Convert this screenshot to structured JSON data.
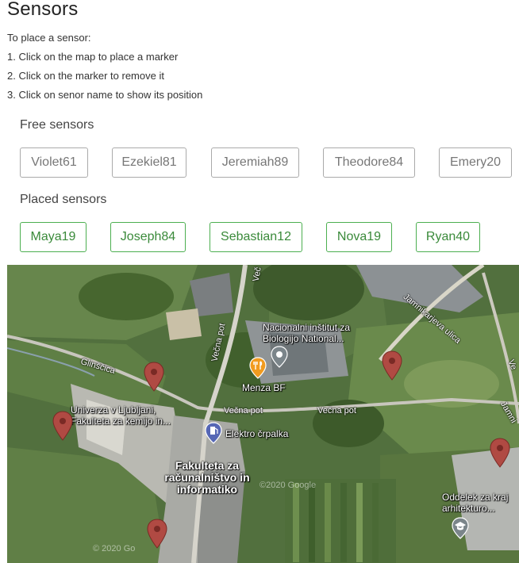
{
  "page": {
    "title": "Sensors",
    "instructions": [
      "To place a sensor:",
      "1. Click on the map to place a marker",
      "2. Click on the marker to remove it",
      "3. Click on senor name to show its position"
    ]
  },
  "free_sensors": {
    "title": "Free sensors",
    "items": [
      "Violet61",
      "Ezekiel81",
      "Jeremiah89",
      "Theodore84",
      "Emery20"
    ]
  },
  "placed_sensors": {
    "title": "Placed sensors",
    "items": [
      "Maya19",
      "Joseph84",
      "Sebastian12",
      "Nova19",
      "Ryan40"
    ]
  },
  "map": {
    "labels": {
      "institute": "Nacionalni inštitut za Biologijo National...",
      "menza": "Menza BF",
      "univerza": "Univerza v Ljubljani, Fakulteta za kemijo in...",
      "elektro": "Elektro črpalka",
      "fri": "Fakulteta za računalništvo in informatiko",
      "oddelek": "Oddelek za kraj arhitekturo..."
    },
    "streets": {
      "glinscica": "Glinščica",
      "vecna_pot_1": "Večna pot",
      "vecna_pot_2": "Večna pot",
      "vecna_pot_3": "Večna pot",
      "vecna_pot_4": "Večna pot",
      "vecna_top": "Več",
      "jamnikarjeva": "Jamnikarjeva ulica",
      "jamni_right": "Jamni",
      "ve_right": "Ve"
    },
    "copyrights": [
      "©2020 Google",
      "© 2020 Go"
    ],
    "marker_color": "#b04a43",
    "marker_count": 5
  }
}
